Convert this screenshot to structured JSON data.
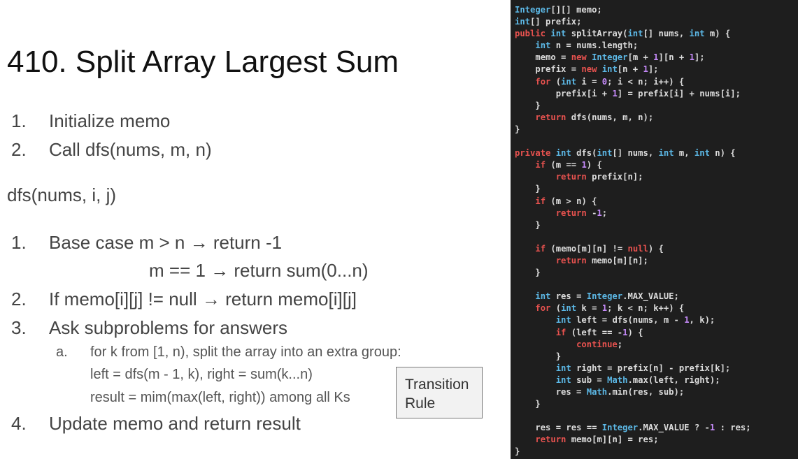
{
  "slide": {
    "title": "410. Split Array Largest Sum",
    "steps_top": [
      {
        "num": "1.",
        "text": "Initialize memo"
      },
      {
        "num": "2.",
        "text": "Call dfs(nums, m, n)"
      }
    ],
    "dfs_signature": "dfs(nums, i, j)",
    "steps": [
      {
        "num": "1.",
        "text": "Base case m > n → return -1"
      },
      {
        "num": "",
        "text": "m == 1 → return sum(0...n)"
      },
      {
        "num": "2.",
        "text": "If memo[i][j] != null → return memo[i][j]"
      },
      {
        "num": "3.",
        "text": "Ask subproblems for answers"
      },
      {
        "num": "4.",
        "text": "Update memo and return result"
      }
    ],
    "substep": {
      "letter": "a.",
      "lines": [
        "for k from [1, n), split the array into an extra group:",
        "left = dfs(m - 1, k), right = sum(k...n)",
        "result = mim(max(left, right)) among all Ks"
      ]
    },
    "callout": {
      "line1": "Transition",
      "line2": "Rule"
    }
  },
  "code": {
    "lines": [
      "Integer[][] memo;",
      "int[] prefix;",
      "public int splitArray(int[] nums, int m) {",
      "    int n = nums.length;",
      "    memo = new Integer[m + 1][n + 1];",
      "    prefix = new int[n + 1];",
      "    for (int i = 0; i < n; i++) {",
      "        prefix[i + 1] = prefix[i] + nums[i];",
      "    }",
      "    return dfs(nums, m, n);",
      "}",
      "",
      "private int dfs(int[] nums, int m, int n) {",
      "    if (m == 1) {",
      "        return prefix[n];",
      "    }",
      "    if (m > n) {",
      "        return -1;",
      "    }",
      "",
      "    if (memo[m][n] != null) {",
      "        return memo[m][n];",
      "    }",
      "",
      "    int res = Integer.MAX_VALUE;",
      "    for (int k = 1; k < n; k++) {",
      "        int left = dfs(nums, m - 1, k);",
      "        if (left == -1) {",
      "            continue;",
      "        }",
      "        int right = prefix[n] - prefix[k];",
      "        int sub = Math.max(left, right);",
      "        res = Math.min(res, sub);",
      "    }",
      "",
      "    res = res == Integer.MAX_VALUE ? -1 : res;",
      "    return memo[m][n] = res;",
      "}"
    ],
    "colors": {
      "background": "#1e1e1e",
      "text": "#dcdcdc",
      "keyword": "#e8524f",
      "type": "#5cb8e6",
      "number": "#c58af9"
    }
  }
}
